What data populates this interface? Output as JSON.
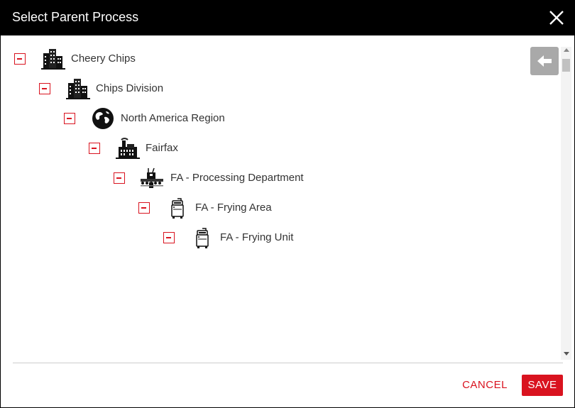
{
  "dialog": {
    "title": "Select Parent Process",
    "close_icon": "close-icon"
  },
  "tree": {
    "nodes": [
      {
        "label": "Cheery Chips",
        "icon": "company-building-icon",
        "expanded": true
      },
      {
        "label": "Chips Division",
        "icon": "division-building-icon",
        "expanded": true
      },
      {
        "label": "North America Region",
        "icon": "globe-icon",
        "expanded": true
      },
      {
        "label": "Fairfax",
        "icon": "factory-icon",
        "expanded": true
      },
      {
        "label": "FA - Processing Department",
        "icon": "processing-line-icon",
        "expanded": true
      },
      {
        "label": "FA - Frying Area",
        "icon": "fryer-icon",
        "expanded": true
      },
      {
        "label": "FA - Frying Unit",
        "icon": "fryer-icon",
        "expanded": true
      }
    ]
  },
  "back_button": {
    "icon": "arrow-left-icon"
  },
  "footer": {
    "cancel_label": "CANCEL",
    "save_label": "SAVE"
  },
  "colors": {
    "accent": "#d9131f",
    "titlebar": "#000000",
    "back_button": "#a9a9a9"
  }
}
